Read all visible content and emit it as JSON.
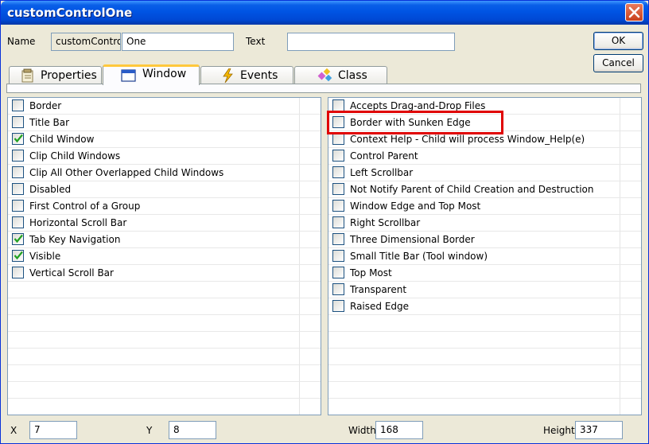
{
  "window": {
    "title": "customControlOne"
  },
  "header": {
    "name_label": "Name",
    "name_prefix": "customContro",
    "name_value": "One",
    "text_label": "Text",
    "text_value": ""
  },
  "buttons": {
    "ok": "OK",
    "cancel": "Cancel"
  },
  "tabs": [
    {
      "label": "Properties",
      "icon": "properties-icon"
    },
    {
      "label": "Window",
      "icon": "window-icon",
      "active": true
    },
    {
      "label": "Events",
      "icon": "lightning-icon"
    },
    {
      "label": "Class",
      "icon": "class-icon"
    }
  ],
  "left_options": [
    {
      "label": "Border",
      "checked": false
    },
    {
      "label": "Title Bar",
      "checked": false
    },
    {
      "label": "Child Window",
      "checked": true
    },
    {
      "label": "Clip Child Windows",
      "checked": false
    },
    {
      "label": "Clip All Other Overlapped Child Windows",
      "checked": false
    },
    {
      "label": "Disabled",
      "checked": false
    },
    {
      "label": "First Control of a Group",
      "checked": false
    },
    {
      "label": "Horizontal Scroll Bar",
      "checked": false
    },
    {
      "label": "Tab Key Navigation",
      "checked": true
    },
    {
      "label": "Visible",
      "checked": true
    },
    {
      "label": "Vertical Scroll Bar",
      "checked": false
    }
  ],
  "right_options": [
    {
      "label": "Accepts Drag-and-Drop Files",
      "checked": false
    },
    {
      "label": "Border with Sunken Edge",
      "checked": false
    },
    {
      "label": "Context Help - Child will process Window_Help(e)",
      "checked": false
    },
    {
      "label": "Control Parent",
      "checked": false
    },
    {
      "label": "Left Scrollbar",
      "checked": false
    },
    {
      "label": "Not Notify Parent of Child Creation and Destruction",
      "checked": false
    },
    {
      "label": "Window Edge and Top Most",
      "checked": false
    },
    {
      "label": "Right Scrollbar",
      "checked": false
    },
    {
      "label": "Three Dimensional Border",
      "checked": false
    },
    {
      "label": "Small Title Bar (Tool window)",
      "checked": false
    },
    {
      "label": "Top Most",
      "checked": false
    },
    {
      "label": "Transparent",
      "checked": false
    },
    {
      "label": "Raised Edge",
      "checked": false
    }
  ],
  "footer": {
    "x_label": "X",
    "x_value": "7",
    "y_label": "Y",
    "y_value": "8",
    "width_label": "Width",
    "width_value": "168",
    "height_label": "Height",
    "height_value": "337"
  },
  "colors": {
    "check": "#21a121",
    "highlight": "#e00000",
    "titlebar": "#0054e3"
  }
}
